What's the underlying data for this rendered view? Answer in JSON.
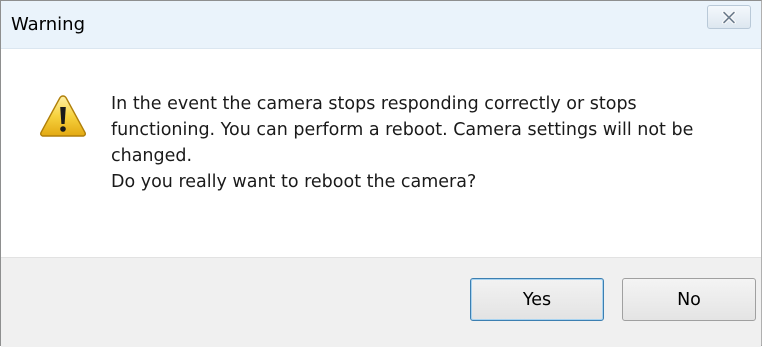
{
  "window": {
    "title": "Warning",
    "close_icon": "close-x-icon"
  },
  "message": {
    "icon": "warning-triangle-icon",
    "paragraph1": "In the event the camera stops responding correctly or stops functioning. You can perform a reboot. Camera settings will not be changed.",
    "paragraph2": "Do you really want to reboot the camera?"
  },
  "buttons": {
    "yes_label": "Yes",
    "no_label": "No"
  },
  "colors": {
    "titlebar_bg": "#eaf3fb",
    "footer_bg": "#f0f0f0",
    "warning_yellow": "#f7d23e",
    "default_button_border": "#3c7fb1"
  }
}
